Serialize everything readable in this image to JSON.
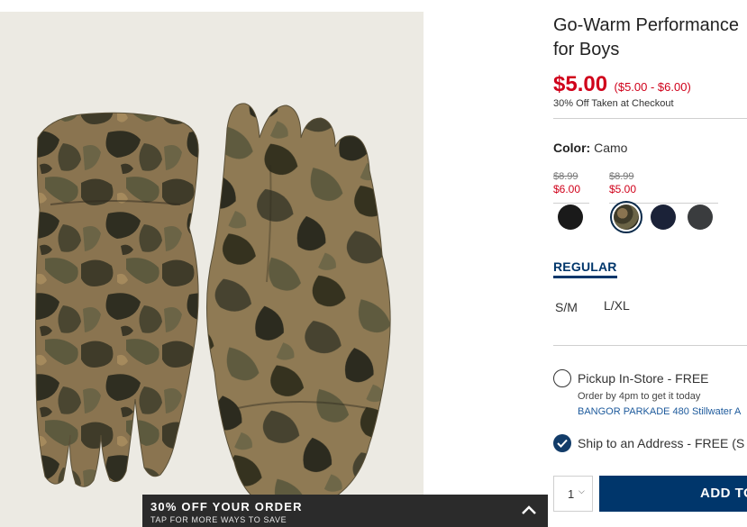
{
  "product": {
    "title_line1": "Go-Warm Performance",
    "title_line2": "for Boys",
    "price_now": "$5.00",
    "price_range": "($5.00 - $6.00)",
    "discount_note": "30% Off Taken at Checkout"
  },
  "color": {
    "label": "Color:",
    "value": "Camo",
    "price_groups": [
      {
        "original": "$8.99",
        "sale": "$6.00"
      },
      {
        "original": "$8.99",
        "sale": "$5.00"
      }
    ],
    "swatches": [
      {
        "name": "black",
        "color": "#1a1a1a"
      },
      {
        "name": "camo",
        "color": "#4a4231",
        "selected": true
      },
      {
        "name": "navy",
        "color": "#1b2238"
      },
      {
        "name": "charcoal",
        "color": "#3a3c3e"
      }
    ]
  },
  "fit": {
    "tab_label": "REGULAR"
  },
  "sizes": [
    "S/M",
    "L/XL"
  ],
  "fulfillment": {
    "pickup_label": "Pickup In-Store - FREE",
    "pickup_note": "Order by 4pm to get it today",
    "pickup_store": "BANGOR PARKADE 480 Stillwater A",
    "ship_label": "Ship to an Address - FREE (S",
    "ship_selected": true
  },
  "cart": {
    "quantity": "1",
    "add_label": "ADD TO"
  },
  "promo": {
    "headline": "30% OFF YOUR ORDER",
    "subtext": "TAP FOR MORE WAYS TO SAVE"
  },
  "colors": {
    "accent_red": "#d0021b",
    "brand_navy": "#00366b"
  }
}
